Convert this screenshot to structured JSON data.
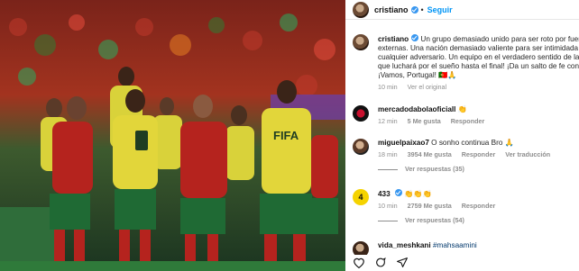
{
  "post": {
    "username": "cristiano",
    "follow_label": "Seguir",
    "separator": "•"
  },
  "caption": {
    "username": "cristiano",
    "text": "Un grupo demasiado unido para ser roto por fuerzas externas. Una nación demasiado valiente para ser intimidada por cualquier adversario. Un equipo en el verdadero sentido de la palabra, que luchará por el sueño hasta el final! ¡Da un salto de fe con nosotros! ¡Vamos, Portugal!",
    "suffix": "🇵🇹🙏",
    "time": "10 min",
    "translate_label": "Ver el original"
  },
  "comments": [
    {
      "username": "mercadodabolaoficiall",
      "text": "👏",
      "time": "12 min",
      "likes": "5 Me gusta",
      "reply_label": "Responder"
    },
    {
      "username": "miguelpaixao7",
      "text": "O sonho continua Bro 🙏",
      "time": "18 min",
      "likes": "3954 Me gusta",
      "reply_label": "Responder",
      "translate_label": "Ver traducción",
      "replies_label": "Ver respuestas (35)"
    },
    {
      "username": "433",
      "text": "👏👏👏",
      "time": "10 min",
      "likes": "2759 Me gusta",
      "reply_label": "Responder",
      "replies_label": "Ver respuestas (54)"
    },
    {
      "username": "vida_meshkani",
      "text": "#mahsaamini"
    }
  ],
  "colors": {
    "accent": "#0095f6",
    "verified": "#3897f0",
    "muted": "#8e8e8e",
    "brand_433": "#f5d300"
  }
}
